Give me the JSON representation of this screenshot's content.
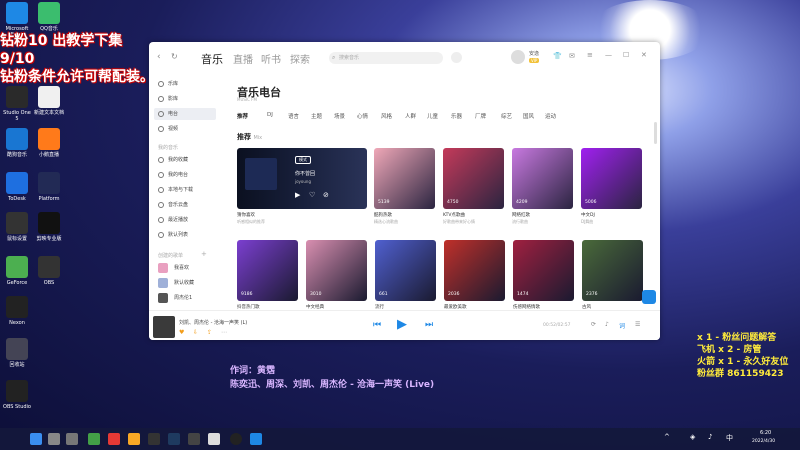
{
  "overlay": {
    "line1": "钻粉10 出教学下集",
    "line2": "9/10",
    "line3": "钻粉条件允许可帮配装。"
  },
  "gift_list": [
    {
      "text": "x 1 - 粉丝问题解答",
      "color": "#ffeb3b"
    },
    {
      "text": "飞机 x 2 - 房管",
      "color": "#ffeb3b"
    },
    {
      "text": "火箭 x 1 - 永久好友位",
      "color": "#ffeb3b"
    },
    {
      "text": "粉丝群 861159423",
      "color": "#ffeb3b"
    }
  ],
  "lyrics": {
    "line1": "作词：黄霑",
    "line2": "陈奕迅、周深、刘凯、周杰伦 - 沧海一声笑 (Live)"
  },
  "desktop_icons": [
    {
      "label": "Microsoft Edge",
      "color": "#1e88e5"
    },
    {
      "label": "QQ音乐",
      "color": "#3bbd6e"
    },
    {
      "label": "新建文本文档",
      "color": "#f0f0f0"
    },
    {
      "label": "Studio One 5",
      "color": "#2a2a2a"
    },
    {
      "label": "酷狗音乐",
      "color": "#1976d2"
    },
    {
      "label": "小鹅直播",
      "color": "#ff7a1a"
    },
    {
      "label": "ToDesk",
      "color": "#1e6fe0"
    },
    {
      "label": "Platform",
      "color": "#222a55"
    },
    {
      "label": "鼠标设置",
      "color": "#333"
    },
    {
      "label": "剪映专业版",
      "color": "#111"
    },
    {
      "label": "GeForce",
      "color": "#4caf50"
    },
    {
      "label": "OBS",
      "color": "#333"
    },
    {
      "label": "Nexon",
      "color": "#222"
    },
    {
      "label": "回收站",
      "color": "#445"
    },
    {
      "label": "OBS Studio",
      "color": "#222"
    }
  ],
  "window": {
    "tabs": [
      "音乐",
      "直播",
      "听书",
      "探索"
    ],
    "search_placeholder": "搜索音乐",
    "user_name": "安逸",
    "vip_badge": "VIP",
    "sidebar": {
      "items": [
        "乐库",
        "影库",
        "电台",
        "视频"
      ],
      "section_my": "我的音乐",
      "my_items": [
        "我的收藏",
        "我的电台",
        "本地与下载",
        "音乐云盘",
        "最近播放",
        "默认列表"
      ],
      "section_playlists": "创建的歌单",
      "playlist_items": [
        "我喜欢",
        "默认收藏",
        "周杰伦1"
      ]
    },
    "main": {
      "title": "音乐电台",
      "subtitle": "MUSIC FM",
      "categories": [
        "推荐",
        "DJ",
        "语言",
        "主题",
        "场景",
        "心情",
        "风格",
        "人群",
        "儿童",
        "乐器",
        "厂牌",
        "综艺",
        "国风",
        "运动"
      ],
      "section_title": "推荐",
      "section_tag": "Mix",
      "cards_row1": [
        {
          "label": "猜你喜欢",
          "sub": "听感相似的推荐",
          "count": "",
          "song": "你不曾回",
          "artist": "joyoung"
        },
        {
          "label": "酷狗热歌",
          "sub": "精选心流歌曲",
          "count": "5139"
        },
        {
          "label": "KTV点歌曲",
          "sub": "好歌曲带来好心情",
          "count": "4750"
        },
        {
          "label": "网络红歌",
          "sub": "流行歌曲",
          "count": "4209"
        },
        {
          "label": "中文DJ",
          "sub": "DJ舞曲",
          "count": "5006"
        }
      ],
      "cards_row2": [
        {
          "label": "抖音热门歌",
          "count": "9186"
        },
        {
          "label": "中文经典",
          "count": "3010"
        },
        {
          "label": "流行",
          "count": "661"
        },
        {
          "label": "最爱欧美歌",
          "count": "2036"
        },
        {
          "label": "伤感网络情歌",
          "count": "1474"
        },
        {
          "label": "古风",
          "count": "2376"
        }
      ],
      "mode_badge": "模式"
    },
    "player": {
      "now_playing": "刘凯、周杰伦 - 沧海一声笑 (L)",
      "time": "00:52/02:57"
    }
  },
  "taskbar": {
    "time": "6:20",
    "date": "2022/4/30"
  }
}
